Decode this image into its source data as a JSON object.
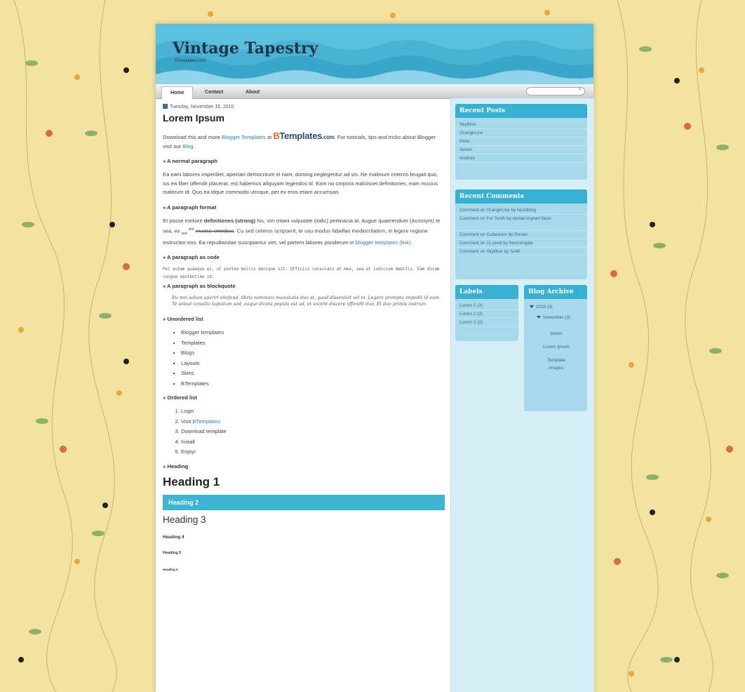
{
  "colors": {
    "accent": "#38b0d1",
    "header": "#5bc0de",
    "sidebar": "#d6eef6",
    "page_bg": "#f3e3a1"
  },
  "header": {
    "title": "Vintage Tapestry",
    "description": "BTemplates.com"
  },
  "nav": {
    "tabs": [
      "Home",
      "Contact",
      "About"
    ],
    "search_icon": "search-icon"
  },
  "post": {
    "date": "Tuesday, November 16, 2010",
    "title": "Lorem Ipsum",
    "intro": {
      "p1": "Download this and more ",
      "link1": "Blogger Templates",
      "p2": " at ",
      "logo_a": "B",
      "logo_b": "Templates",
      "logo_c": ".com",
      "p3": ". For tutorials, tips and tricks about Blogger visit our ",
      "link2": "Blog",
      "p4": "."
    },
    "sections": {
      "normal": {
        "heading": "» A normal paragraph",
        "text": "Ea eam labores imperdiet, apeirian democritum ei nam, doming neglegentur ad vis. Ne malorum ceteros feugait quo, ius ea liber offendit placerat, est habemus aliquyam legendos id. Eam no corpora maluisset definitiones, eam mucius malorum id. Quo ea idque commodo utroque, per ex eros etiam accumsan."
      },
      "format": {
        "heading": "» A paragraph format",
        "t1": "Et posse meliore ",
        "bold": "definitiones (strong)",
        "t2": " his, vim tritani vulputate (italic) pertinacia at. Augue quaerendum (Acronym) te sea, ex ",
        "sub": "sed",
        "sup": "sint",
        "strike": "mucius omnibus",
        "t3": ". Cu sed ceteros scripserit, te usu modus fabellas mediocritatem, in legere regione instructior eos. Ea repudiandae suscipiantur vim, vel partem labores ponderum in ",
        "link": "blogger templates (link)",
        "t4": "."
      },
      "code": {
        "heading": "» A paragraph as code",
        "text": "Pel autem quaeque ei, ut postea mollis denique sit. Officiis consulatu at mea, sea at iudicium debitis. Eam dicam congue sententiae id."
      },
      "quote": {
        "heading": "» A paragraph as blockquote",
        "text": "Eu mei solum aperiri eleifend, libris nominavi maiestatis duo at, quod dissentiet vel in. Legere prompta impedit id eum. Te soleat consilio luptatum sed, eaque diceta populo est ad, et vocent discere offendit duo. Et duo primis instrum."
      },
      "ul": {
        "heading": "» Unordered list",
        "items": [
          "Blogger templates",
          "Templates",
          "Blogs",
          "Layouts",
          "Skins",
          "BTemplates"
        ]
      },
      "ol": {
        "heading": "» Ordered list",
        "items": [
          "Login",
          "Visit BTemplates",
          "Download template",
          "Install",
          "Enjoy!"
        ],
        "link_item_prefix": "Visit ",
        "link_item_link": "BTemplates"
      },
      "heading": {
        "heading": "» Heading",
        "h1": "Heading 1",
        "h2": "Heading 2",
        "h3": "Heading 3",
        "h4": "Heading 4",
        "h5": "Heading 5",
        "h6": "Heading 6"
      }
    }
  },
  "sidebar": {
    "recent_posts": {
      "title": "Recent Posts",
      "items": [
        "SkyBlue",
        "OrangeLine",
        "Hello",
        "Seven",
        "Instituts"
      ]
    },
    "recent_comments": {
      "title": "Recent Comments",
      "items": [
        "Comment on OrangeLine by liquidblog",
        "Comment on For Teeth by dental implant facts",
        "Comment on Cubestore by Renee",
        "Comment on 21 pixel by freemergale",
        "Comment on SkyBlue by SAM"
      ]
    },
    "labels": {
      "title": "Labels",
      "items": [
        "Lorem 1 (3)",
        "Lorem 2 (3)",
        "Lorem 3 (2)"
      ]
    },
    "archive": {
      "title": "Blog Archive",
      "year": "2010 (3)",
      "month": "November (3)",
      "posts": [
        "Ipsum",
        "Lorem Ipsum",
        "Template images"
      ]
    }
  }
}
